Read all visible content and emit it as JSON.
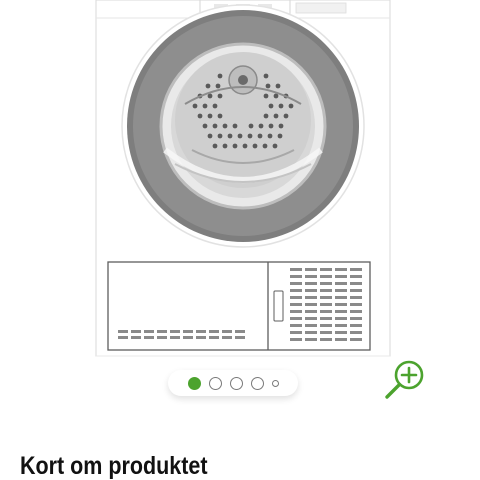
{
  "product": {
    "section_title": "Kort om produktet"
  },
  "gallery": {
    "image_name": "product-image-tumble-dryer",
    "dot_count": 5,
    "active_index": 0
  },
  "colors": {
    "accent": "#4ca32e",
    "dot_inactive": "#7a7a7a",
    "title_text": "#111111"
  },
  "icons": {
    "zoom": "zoom-in-icon"
  }
}
